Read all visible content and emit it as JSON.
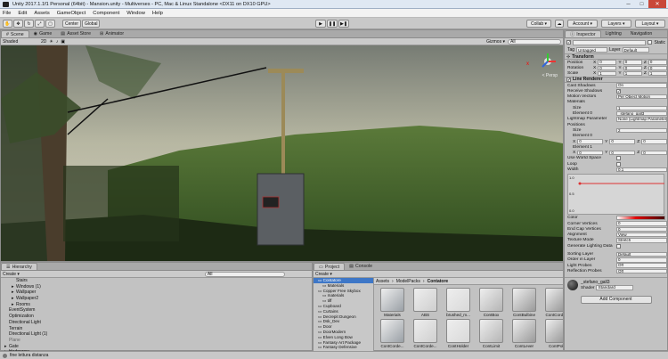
{
  "window": {
    "title": "Unity 2017.1.1f1 Personal (64bit) - Mansion.unity - Multiverses - PC, Mac & Linux Standalone <DX11 on DX10 GPU>",
    "minimize": "─",
    "maximize": "□",
    "close": "✕"
  },
  "menu": [
    "File",
    "Edit",
    "Assets",
    "GameObject",
    "Component",
    "Window",
    "Help"
  ],
  "toolbar": {
    "center_label": "Center",
    "global_label": "Global",
    "play": "▶",
    "pause": "❚❚",
    "step": "▶❚",
    "collab": "Collab ▾",
    "account": "Account ▾",
    "layers": "Layers ▾",
    "layout": "Layout ▾"
  },
  "scene": {
    "tabs": [
      "Scene",
      "Game",
      "Asset Store",
      "Animator"
    ],
    "shading": "Shaded",
    "mode_2d": "2D",
    "gizmos": "Gizmos ▾",
    "search_placeholder": "All",
    "persp_label": "< Persp"
  },
  "hierarchy": {
    "tab": "Hierarchy",
    "create": "Create ▾",
    "search_placeholder": "All",
    "items": [
      {
        "label": "Stairs",
        "depth": 1,
        "fold": ""
      },
      {
        "label": "Windows (1)",
        "depth": 1,
        "fold": "▸"
      },
      {
        "label": "Wallpaper",
        "depth": 1,
        "fold": "▸"
      },
      {
        "label": "Wallpaper2",
        "depth": 1,
        "fold": "▸"
      },
      {
        "label": "Rooms",
        "depth": 1,
        "fold": "▸"
      },
      {
        "label": "EventSystem",
        "depth": 0,
        "fold": ""
      },
      {
        "label": "Optimization",
        "depth": 0,
        "fold": ""
      },
      {
        "label": "Directional Light",
        "depth": 0,
        "fold": ""
      },
      {
        "label": "Terrain",
        "depth": 0,
        "fold": ""
      },
      {
        "label": "Directional Light (1)",
        "depth": 0,
        "fold": ""
      },
      {
        "label": "Plane",
        "depth": 0,
        "fold": "",
        "dim": true
      },
      {
        "label": "Gate",
        "depth": 0,
        "fold": "▸"
      },
      {
        "label": "Hedgerow",
        "depth": 0,
        "fold": "▸"
      },
      {
        "label": "Water4SimpleReflectionSceneCamera",
        "depth": 0,
        "fold": ""
      },
      {
        "label": "Cables",
        "depth": 0,
        "fold": "▸"
      }
    ]
  },
  "project": {
    "tabs": [
      "Project",
      "Console"
    ],
    "create": "Create ▾",
    "tree": [
      {
        "label": "Contatore",
        "sel": true,
        "depth": 1
      },
      {
        "label": "Materials",
        "depth": 2
      },
      {
        "label": "Copper Free Skybox",
        "depth": 1
      },
      {
        "label": "materials",
        "depth": 2
      },
      {
        "label": "tiff",
        "depth": 2
      },
      {
        "label": "Cupboard",
        "depth": 1
      },
      {
        "label": "Curtains",
        "depth": 1
      },
      {
        "label": "Decrepit Dungeon",
        "depth": 1
      },
      {
        "label": "Dsk_Dev",
        "depth": 1
      },
      {
        "label": "Door",
        "depth": 1
      },
      {
        "label": "DoorModern",
        "depth": 1
      },
      {
        "label": "Elven Long Bow",
        "depth": 1
      },
      {
        "label": "Fantasy Art Package",
        "depth": 1
      },
      {
        "label": "Fantasy Defensive",
        "depth": 1
      }
    ],
    "breadcrumb": [
      "Assets",
      "ModelPacks",
      "Contatore"
    ],
    "assets_row1": [
      "Materials",
      "ABS",
      "brushed_m...",
      "ContBox",
      "ContBulbine",
      "ContCorde..."
    ],
    "assets_row2": [
      "ContCorde...",
      "ContCorde...",
      "ContHolder",
      "ContLimit",
      "ContLever",
      "ContPole"
    ]
  },
  "inspector": {
    "tabs": [
      "Inspector",
      "Lighting",
      "Navigation"
    ],
    "static": "Static",
    "tag": "Untagged",
    "layer": "Default",
    "transform": {
      "title": "Transform",
      "rows": [
        {
          "label": "Position",
          "x": "0",
          "y": "0",
          "z": "0"
        },
        {
          "label": "Rotation",
          "x": "0",
          "y": "0",
          "z": "0"
        },
        {
          "label": "Scale",
          "x": "1",
          "y": "1",
          "z": "1"
        }
      ]
    },
    "line": {
      "title": "Line Renderer",
      "cast_shadows": "On",
      "receive_shadows": true,
      "motion_vectors": "Per Object Motion",
      "materials": "Materials",
      "mat_size": "1",
      "element0": "_stefano_gall3",
      "lightmap": "None (Lightmap Parameters)",
      "positions": "Positions",
      "pos_size": "2",
      "e0": {
        "x": "0",
        "y": "0",
        "z": "0"
      },
      "e1": {
        "x": "0",
        "y": "0",
        "z": "0"
      },
      "use_world": "Use World Space",
      "loop": "Loop",
      "width": "Width",
      "width_val": "0.1",
      "curve_labels": [
        "1.0",
        "0.5",
        "0.0"
      ],
      "color": "Color",
      "corner": "Corner Vertices",
      "corner_val": "0",
      "endcap": "End Cap Vertices",
      "endcap_val": "0",
      "alignment": "Alignment",
      "alignment_val": "View",
      "texture_mode": "Texture Mode",
      "texture_val": "Stretch",
      "gen_light": "Generate Lighting Data",
      "sorting": "Sorting Layer",
      "sorting_val": "Default",
      "order": "Order in Layer",
      "order_val": "0",
      "light_probes": "Light Probes",
      "light_probes_val": "Off",
      "refl": "Reflection Probes",
      "refl_val": "Off"
    },
    "material": {
      "name": "_stefano_gall3",
      "shader_label": "Shader",
      "shader": "Standard"
    },
    "add_component": "Add Component"
  },
  "status": {
    "text": "fine lettura distanza"
  },
  "colors": {
    "accent": "#3e77c7"
  }
}
